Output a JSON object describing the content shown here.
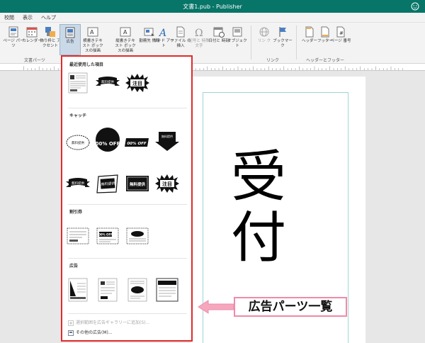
{
  "window": {
    "title": "文書1.pub - Publisher"
  },
  "menu": [
    "校閲",
    "表示",
    "ヘルプ"
  ],
  "ribbon": {
    "buttons": [
      {
        "id": "page-parts",
        "label": "ページ パーツ"
      },
      {
        "id": "calendar",
        "label": "カレンダー"
      },
      {
        "id": "borders",
        "label": "飾り枠と アクセント"
      },
      {
        "id": "ad",
        "label": "広告"
      },
      {
        "id": "h-textbox",
        "label": "横書きテキスト ボックスの描画"
      },
      {
        "id": "v-textbox",
        "label": "縦書きテキスト ボックスの描画"
      },
      {
        "id": "business-info",
        "label": "勤務先 情報"
      },
      {
        "id": "wordart",
        "label": "ワード アート"
      },
      {
        "id": "insert-file",
        "label": "ファイル の挿入"
      },
      {
        "id": "symbol",
        "label": "記号と 特殊文字"
      },
      {
        "id": "date-time",
        "label": "日付と 時刻"
      },
      {
        "id": "object",
        "label": "オブジェクト"
      },
      {
        "id": "link",
        "label": "リン ク"
      },
      {
        "id": "bookmark",
        "label": "ブックマーク"
      },
      {
        "id": "header",
        "label": "ヘッダー"
      },
      {
        "id": "footer",
        "label": "フッター"
      },
      {
        "id": "page-number",
        "label": "ページ 番号"
      }
    ],
    "groups": [
      "文書パーツ",
      "リンク",
      "ヘッダーとフッター"
    ]
  },
  "gallery": {
    "sections": [
      "最近使用した項目",
      "キャッチ",
      "割引券",
      "広告"
    ],
    "thumb_texts": {
      "free": "無料提供",
      "pct": "00% OFF",
      "pct_italic": "00% OFF",
      "attention": "注目"
    },
    "footer_links": [
      {
        "label": "選択範囲を広告ギャラリーに追加(S)...",
        "disabled": true
      },
      {
        "label": "その他の広告(M)...",
        "disabled": false
      }
    ]
  },
  "document": {
    "line1": "受",
    "line2": "付"
  },
  "callout": {
    "label": "広告パーツ一覧"
  },
  "colors": {
    "accent": "#077568",
    "highlight": "#e02a2a",
    "callout_border": "#f08aa8"
  }
}
